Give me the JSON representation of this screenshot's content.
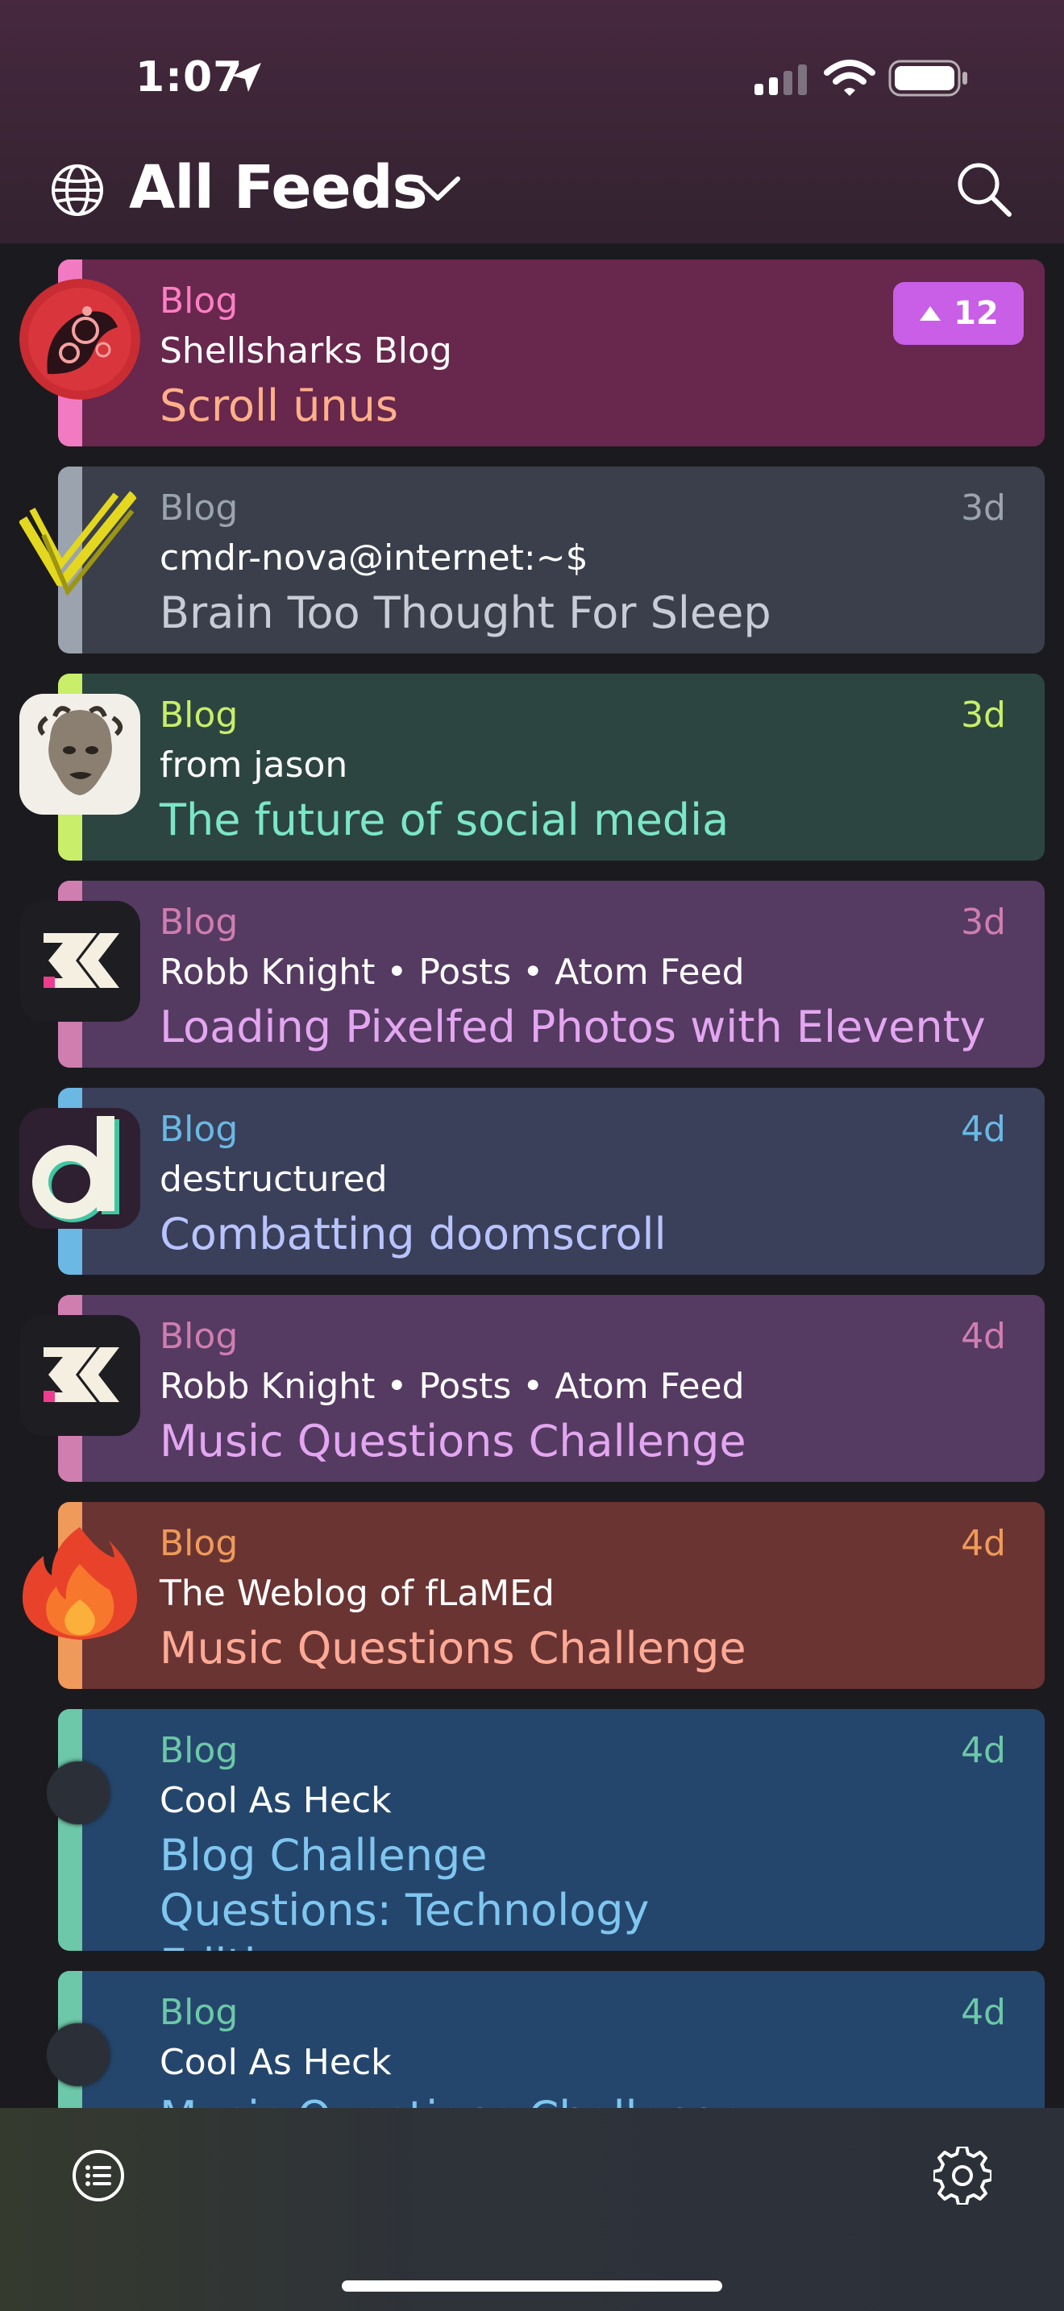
{
  "status_bar": {
    "time": "1:07"
  },
  "header": {
    "title": "All Feeds"
  },
  "feeds": [
    {
      "category": "Blog",
      "source": "Shellsharks Blog",
      "title": "Scroll ūnus",
      "age": "",
      "badge": "12",
      "colors": {
        "bg": "#68274d",
        "stripe": "#f27ac2",
        "cat": "#ff7fc5",
        "title": "#ffb08a"
      }
    },
    {
      "category": "Blog",
      "source": "cmdr-nova@internet:~$",
      "title": "Brain Too Thought For Sleep",
      "age": "3d",
      "colors": {
        "bg": "#3a3f4b",
        "stripe": "#9aa3ae",
        "cat": "#9aa3ae",
        "title": "#c7ccd6"
      }
    },
    {
      "category": "Blog",
      "source": "from jason",
      "title": "The future of social media",
      "age": "3d",
      "colors": {
        "bg": "#2d4540",
        "stripe": "#c8ee6a",
        "cat": "#c8ee6a",
        "title": "#7be6c8"
      }
    },
    {
      "category": "Blog",
      "source": "Robb Knight • Posts • Atom Feed",
      "title": "Loading Pixelfed Photos with Eleventy",
      "age": "3d",
      "colors": {
        "bg": "#553a62",
        "stripe": "#d07db0",
        "cat": "#d07db0",
        "title": "#e3a6f0"
      }
    },
    {
      "category": "Blog",
      "source": "destructured",
      "title": "Combatting doomscroll",
      "age": "4d",
      "colors": {
        "bg": "#3a3f5a",
        "stripe": "#6ab8e3",
        "cat": "#6ab8e3",
        "title": "#b9c4ff"
      }
    },
    {
      "category": "Blog",
      "source": "Robb Knight • Posts • Atom Feed",
      "title": "Music Questions Challenge",
      "age": "4d",
      "colors": {
        "bg": "#553a62",
        "stripe": "#d07db0",
        "cat": "#d07db0",
        "title": "#e3a6f0"
      }
    },
    {
      "category": "Blog",
      "source": "The Weblog of fLaMEd",
      "title": "Music Questions Challenge",
      "age": "4d",
      "colors": {
        "bg": "#6a3433",
        "stripe": "#ef9a5a",
        "cat": "#ef9a5a",
        "title": "#ffaa96"
      }
    },
    {
      "category": "Blog",
      "source": "Cool As Heck",
      "title": "Blog Challenge Questions: Technology Edition",
      "age": "4d",
      "colors": {
        "bg": "#25466c",
        "stripe": "#6cc8a8",
        "cat": "#6cc8a8",
        "title": "#7fc6f0"
      }
    },
    {
      "category": "Blog",
      "source": "Cool As Heck",
      "title": "Music Questions Challenge",
      "age": "4d",
      "colors": {
        "bg": "#25466c",
        "stripe": "#6cc8a8",
        "cat": "#6cc8a8",
        "title": "#7fc6f0"
      }
    }
  ],
  "icons": {
    "status": [
      "location-arrow-icon",
      "cellular-signal-icon",
      "wifi-icon",
      "battery-icon"
    ],
    "header": [
      "globe-icon",
      "chevron-down-icon",
      "search-icon"
    ],
    "toolbar": [
      "list-icon",
      "gear-icon"
    ]
  }
}
